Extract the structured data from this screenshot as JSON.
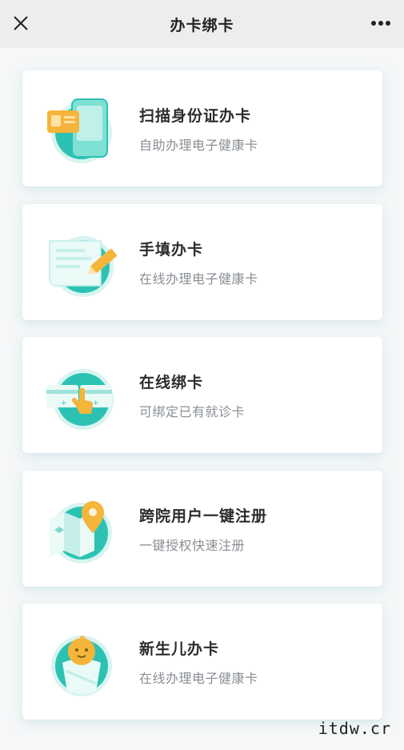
{
  "header": {
    "title": "办卡绑卡",
    "close_icon": "close-icon",
    "more_icon": "more-dots-icon"
  },
  "cards": [
    {
      "title": "扫描身份证办卡",
      "subtitle": "自助办理电子健康卡",
      "icon": "id-card-scan-icon"
    },
    {
      "title": "手填办卡",
      "subtitle": "在线办理电子健康卡",
      "icon": "form-pencil-icon"
    },
    {
      "title": "在线绑卡",
      "subtitle": "可绑定已有就诊卡",
      "icon": "card-tap-icon"
    },
    {
      "title": "跨院用户一键注册",
      "subtitle": "一键授权快速注册",
      "icon": "map-location-icon"
    },
    {
      "title": "新生儿办卡",
      "subtitle": "在线办理电子健康卡",
      "icon": "newborn-baby-icon"
    }
  ],
  "watermark": "itdw.cr",
  "colors": {
    "teal": "#2cc2b3",
    "light_teal": "#d8f4f0",
    "orange": "#f5b53a",
    "title": "#2c2c2c",
    "subtitle": "#8a8f94"
  }
}
